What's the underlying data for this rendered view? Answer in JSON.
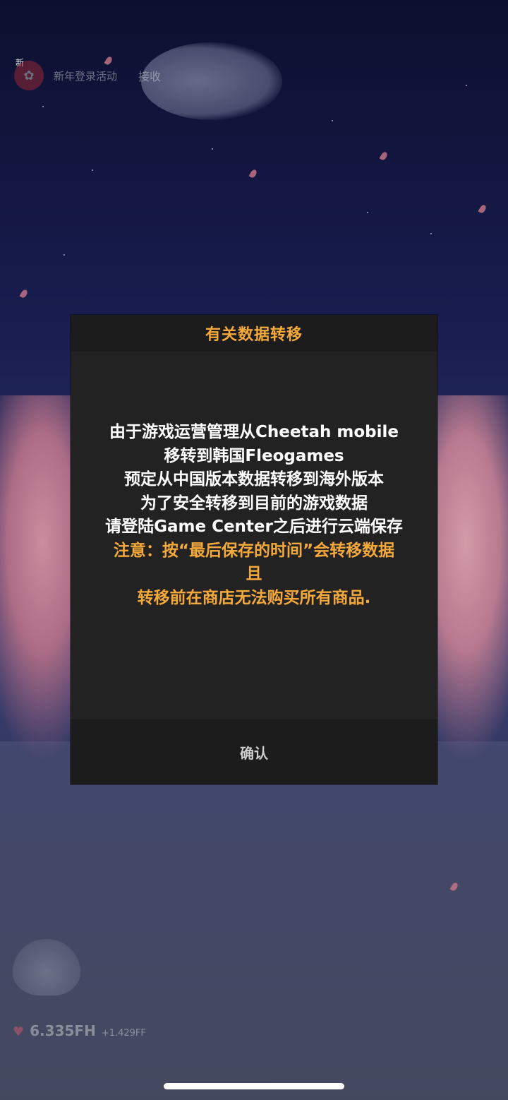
{
  "event": {
    "badge": "新",
    "label": "新年登录活动",
    "receive": "接收"
  },
  "stats": {
    "main": "6.335FH",
    "sub": "+1.429FF"
  },
  "dialog": {
    "title": "有关数据转移",
    "lines": [
      "由于游戏运营管理从Cheetah mobile",
      "移转到韩国Fleogames",
      "预定从中国版本数据转移到海外版本",
      "为了安全转移到目前的游戏数据",
      "请登陆Game Center之后进行云端保存"
    ],
    "warning_lines": [
      "注意：按“最后保存的时间”会转移数据",
      "且",
      "转移前在商店无法购买所有商品."
    ],
    "confirm_label": "确认"
  },
  "colors": {
    "accent": "#f4a93a",
    "dialog_bg": "#222222",
    "dialog_bar_bg": "#1c1c1c"
  }
}
